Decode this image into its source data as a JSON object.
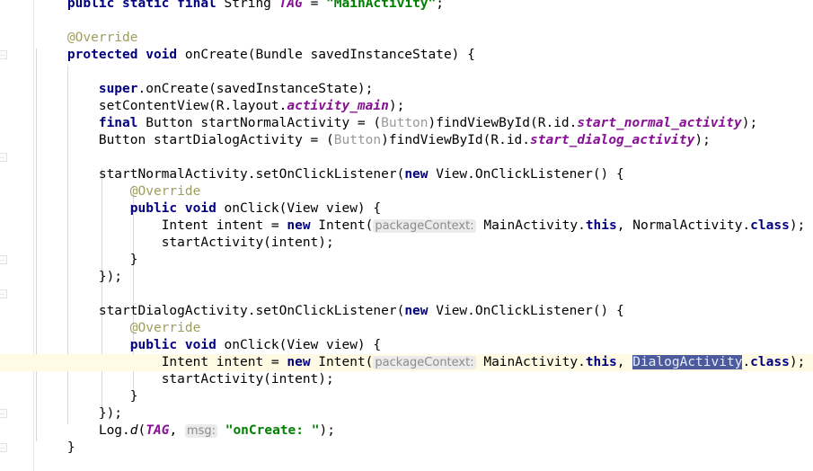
{
  "editor": {
    "language": "java",
    "colors": {
      "background": "#ffffff",
      "keyword": "#000080",
      "string": "#008000",
      "static_field": "#871094",
      "annotation": "#9e9e5f",
      "cast_grayed": "#999999",
      "inline_hint_bg": "#ebebeb",
      "inline_hint_fg": "#8c8c8c",
      "selection_bg": "#4b5b9e",
      "selection_fg": "#e9ecf7",
      "current_line_bg": "#fffae3",
      "gutter_border": "#e8e8e8",
      "indent_guide": "#d8d8d8",
      "bulb_yellow": "#f5c518"
    },
    "gutter": {
      "bulb_icon": "lightbulb-icon",
      "bulb_line_index": 21,
      "fold_marker_icon": "fold-marker-icon",
      "fold_marker_line_indices": [
        3,
        9,
        15,
        17,
        24,
        26
      ]
    },
    "current_line_index": 21,
    "selection": {
      "text": "DialogActivity",
      "line_index": 21
    },
    "lines": [
      {
        "i": 0,
        "indent": 1,
        "tokens": [
          {
            "t": "kw",
            "v": "public static final "
          },
          {
            "t": "plain",
            "v": "String "
          },
          {
            "t": "fieldstatic",
            "v": "TAG"
          },
          {
            "t": "plain",
            "v": " = "
          },
          {
            "t": "str",
            "v": "\"MainActivity\""
          },
          {
            "t": "plain",
            "v": ";"
          }
        ]
      },
      {
        "i": 1,
        "indent": 1,
        "tokens": []
      },
      {
        "i": 2,
        "indent": 1,
        "tokens": [
          {
            "t": "anno",
            "v": "@Override"
          }
        ]
      },
      {
        "i": 3,
        "indent": 1,
        "tokens": [
          {
            "t": "kw",
            "v": "protected void "
          },
          {
            "t": "plain",
            "v": "onCreate(Bundle savedInstanceState) {"
          }
        ]
      },
      {
        "i": 4,
        "indent": 2,
        "tokens": []
      },
      {
        "i": 5,
        "indent": 2,
        "tokens": [
          {
            "t": "kw",
            "v": "super"
          },
          {
            "t": "plain",
            "v": ".onCreate(savedInstanceState);"
          }
        ]
      },
      {
        "i": 6,
        "indent": 2,
        "tokens": [
          {
            "t": "plain",
            "v": "setContentView(R.layout."
          },
          {
            "t": "fieldstatic",
            "v": "activity_main"
          },
          {
            "t": "plain",
            "v": ");"
          }
        ]
      },
      {
        "i": 7,
        "indent": 2,
        "tokens": [
          {
            "t": "kw",
            "v": "final "
          },
          {
            "t": "plain",
            "v": "Button startNormalActivity = ("
          },
          {
            "t": "cast",
            "v": "Button"
          },
          {
            "t": "plain",
            "v": ")findViewById(R.id."
          },
          {
            "t": "fieldstatic",
            "v": "start_normal_activity"
          },
          {
            "t": "plain",
            "v": ");"
          }
        ]
      },
      {
        "i": 8,
        "indent": 2,
        "tokens": [
          {
            "t": "plain",
            "v": "Button startDialogActivity = ("
          },
          {
            "t": "cast",
            "v": "Button"
          },
          {
            "t": "plain",
            "v": ")findViewById(R.id."
          },
          {
            "t": "fieldstatic",
            "v": "start_dialog_activity"
          },
          {
            "t": "plain",
            "v": ");"
          }
        ]
      },
      {
        "i": 9,
        "indent": 2,
        "tokens": []
      },
      {
        "i": 10,
        "indent": 2,
        "tokens": [
          {
            "t": "plain",
            "v": "startNormalActivity.setOnClickListener("
          },
          {
            "t": "kw",
            "v": "new "
          },
          {
            "t": "plain",
            "v": "View.OnClickListener() {"
          }
        ]
      },
      {
        "i": 11,
        "indent": 3,
        "tokens": [
          {
            "t": "anno",
            "v": "@Override"
          }
        ]
      },
      {
        "i": 12,
        "indent": 3,
        "tokens": [
          {
            "t": "kw",
            "v": "public void "
          },
          {
            "t": "plain",
            "v": "onClick(View view) {"
          }
        ]
      },
      {
        "i": 13,
        "indent": 4,
        "tokens": [
          {
            "t": "plain",
            "v": "Intent intent = "
          },
          {
            "t": "kw",
            "v": "new "
          },
          {
            "t": "plain",
            "v": "Intent("
          },
          {
            "t": "hint",
            "v": "packageContext:"
          },
          {
            "t": "plain",
            "v": " MainActivity."
          },
          {
            "t": "kw",
            "v": "this"
          },
          {
            "t": "plain",
            "v": ", NormalActivity."
          },
          {
            "t": "kw",
            "v": "class"
          },
          {
            "t": "plain",
            "v": ");"
          }
        ]
      },
      {
        "i": 14,
        "indent": 4,
        "tokens": [
          {
            "t": "plain",
            "v": "startActivity(intent);"
          }
        ]
      },
      {
        "i": 15,
        "indent": 3,
        "tokens": [
          {
            "t": "plain",
            "v": "}"
          }
        ]
      },
      {
        "i": 16,
        "indent": 2,
        "tokens": [
          {
            "t": "plain",
            "v": "});"
          }
        ]
      },
      {
        "i": 17,
        "indent": 2,
        "tokens": []
      },
      {
        "i": 18,
        "indent": 2,
        "tokens": [
          {
            "t": "plain",
            "v": "startDialogActivity.setOnClickListener("
          },
          {
            "t": "kw",
            "v": "new "
          },
          {
            "t": "plain",
            "v": "View.OnClickListener() {"
          }
        ]
      },
      {
        "i": 19,
        "indent": 3,
        "tokens": [
          {
            "t": "anno",
            "v": "@Override"
          }
        ]
      },
      {
        "i": 20,
        "indent": 3,
        "tokens": [
          {
            "t": "kw",
            "v": "public void "
          },
          {
            "t": "plain",
            "v": "onClick(View view) {"
          }
        ]
      },
      {
        "i": 21,
        "indent": 4,
        "tokens": [
          {
            "t": "plain",
            "v": "Intent intent = "
          },
          {
            "t": "kw",
            "v": "new "
          },
          {
            "t": "plain",
            "v": "Intent("
          },
          {
            "t": "hint",
            "v": "packageContext:"
          },
          {
            "t": "plain",
            "v": " MainActivity."
          },
          {
            "t": "kw",
            "v": "this"
          },
          {
            "t": "plain",
            "v": ", "
          },
          {
            "t": "sel",
            "v": "DialogActivity"
          },
          {
            "t": "plain",
            "v": "."
          },
          {
            "t": "kw",
            "v": "class"
          },
          {
            "t": "plain",
            "v": ");"
          }
        ]
      },
      {
        "i": 22,
        "indent": 4,
        "tokens": [
          {
            "t": "plain",
            "v": "startActivity(intent);"
          }
        ]
      },
      {
        "i": 23,
        "indent": 3,
        "tokens": [
          {
            "t": "plain",
            "v": "}"
          }
        ]
      },
      {
        "i": 24,
        "indent": 2,
        "tokens": [
          {
            "t": "plain",
            "v": "});"
          }
        ]
      },
      {
        "i": 25,
        "indent": 2,
        "tokens": [
          {
            "t": "plain",
            "v": "Log."
          },
          {
            "t": "methi",
            "v": "d"
          },
          {
            "t": "plain",
            "v": "("
          },
          {
            "t": "fieldstatic",
            "v": "TAG"
          },
          {
            "t": "plain",
            "v": ", "
          },
          {
            "t": "hint",
            "v": "msg:"
          },
          {
            "t": "plain",
            "v": " "
          },
          {
            "t": "str",
            "v": "\"onCreate: \""
          },
          {
            "t": "plain",
            "v": ");"
          }
        ]
      },
      {
        "i": 26,
        "indent": 1,
        "tokens": [
          {
            "t": "plain",
            "v": "}"
          }
        ]
      }
    ]
  }
}
